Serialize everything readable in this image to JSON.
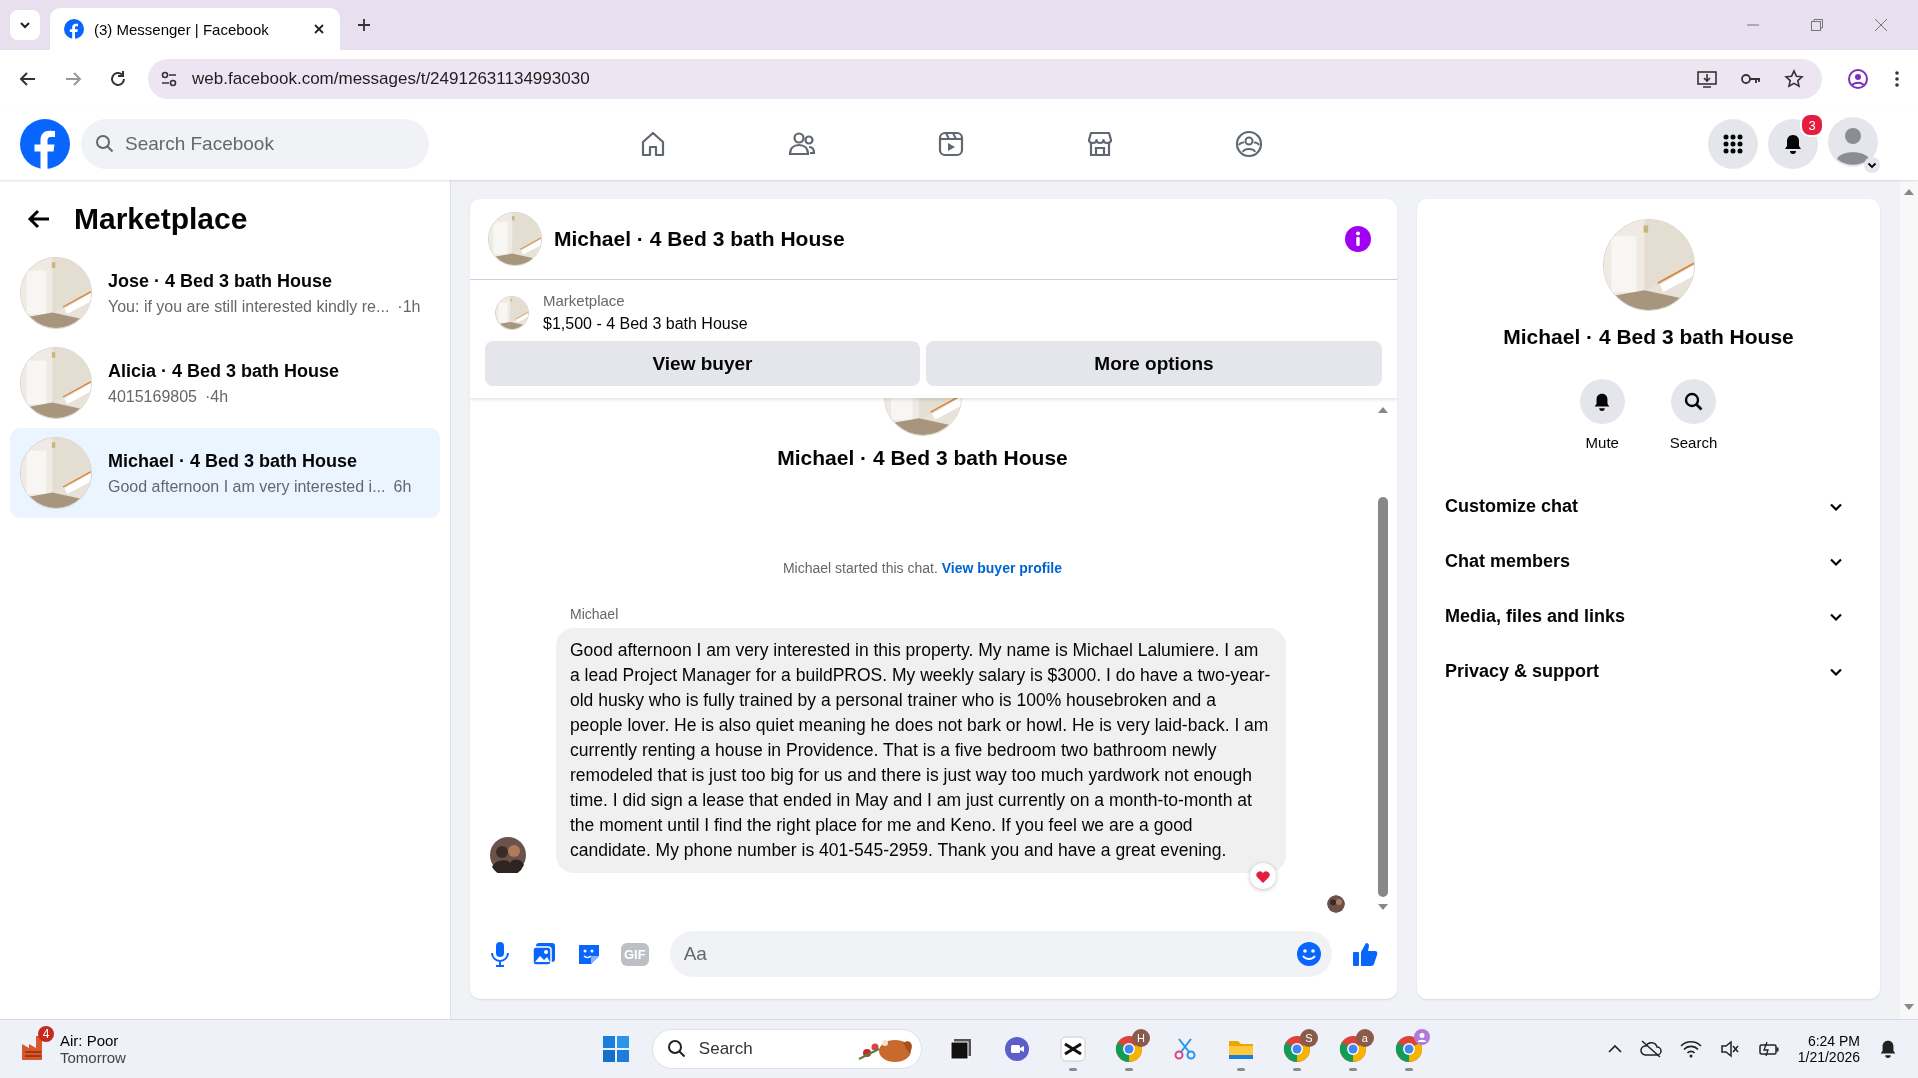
{
  "browser": {
    "tab_title": "(3) Messenger | Facebook",
    "url": "web.facebook.com/messages/t/24912631134993030"
  },
  "header": {
    "search_placeholder": "Search Facebook",
    "notification_count": "3"
  },
  "sidebar": {
    "title": "Marketplace",
    "conversations": [
      {
        "name": "Jose · 4 Bed 3 bath House",
        "preview": "You: if you are still interested kindly re...",
        "time": "·1h",
        "selected": false
      },
      {
        "name": "Alicia · 4 Bed 3 bath House",
        "preview": "4015169805",
        "time": "·4h",
        "selected": false
      },
      {
        "name": "Michael · 4 Bed 3 bath House",
        "preview": "Good afternoon I am very interested i...",
        "time": "6h",
        "selected": true
      }
    ]
  },
  "chat": {
    "title": "Michael · 4 Bed 3 bath House",
    "listing": {
      "source": "Marketplace",
      "title": "$1,500 - 4 Bed 3 bath House"
    },
    "buttons": [
      "View buyer",
      "More options"
    ],
    "intro_name": "Michael · 4 Bed 3 bath House",
    "started_text": "Michael started this chat.",
    "profile_link": "View buyer profile",
    "messages": [
      {
        "sender": "Michael",
        "text": "Good afternoon I am very interested in this property. My name is Michael Lalumiere. I am a lead Project Manager for a buildPROS. My weekly salary is $3000. I do have a two-year-old husky who is fully trained by a personal trainer who is 100% housebroken and a people lover. He is also quiet meaning he does not bark or howl. He is very laid-back. I am currently renting a house in Providence. That is a five bedroom two bathroom newly remodeled that is just too big for us and there is just way too much yardwork not enough time. I did sign a lease that ended in May and I am just currently on a month-to-month at the moment until I find the right place for me and Keno. If you feel we are a good candidate. My phone number is 401-545-2959. Thank you and have a great evening.",
        "reacted": true
      }
    ],
    "composer": {
      "placeholder": "Aa",
      "gif_label": "GIF"
    }
  },
  "details": {
    "title": "Michael · 4 Bed 3 bath House",
    "actions": [
      {
        "label": "Mute",
        "kind": "bell"
      },
      {
        "label": "Search",
        "kind": "search"
      }
    ],
    "sections": [
      {
        "label": "Customize chat",
        "expanded": false
      },
      {
        "label": "Chat members",
        "expanded": false
      },
      {
        "label": "Media, files and links",
        "expanded": false
      },
      {
        "label": "Privacy & support",
        "expanded": false
      }
    ]
  },
  "taskbar": {
    "weather_badge": "4",
    "weather": "Air: Poor",
    "weather_sub": "Tomorrow",
    "search": "Search",
    "apps": [
      {
        "kind": "taskview",
        "running": false
      },
      {
        "kind": "chat",
        "running": false
      },
      {
        "kind": "capcut",
        "running": true
      },
      {
        "kind": "chrome",
        "badge": "H",
        "running": true
      },
      {
        "kind": "snip",
        "running": false
      },
      {
        "kind": "folder",
        "running": true
      },
      {
        "kind": "chrome",
        "badge": "S",
        "running": true
      },
      {
        "kind": "chrome",
        "badge": "a",
        "running": true
      },
      {
        "kind": "chrome",
        "profile_badge": true,
        "running": true
      }
    ],
    "time": "6:24 PM",
    "date": "1/21/2026"
  }
}
